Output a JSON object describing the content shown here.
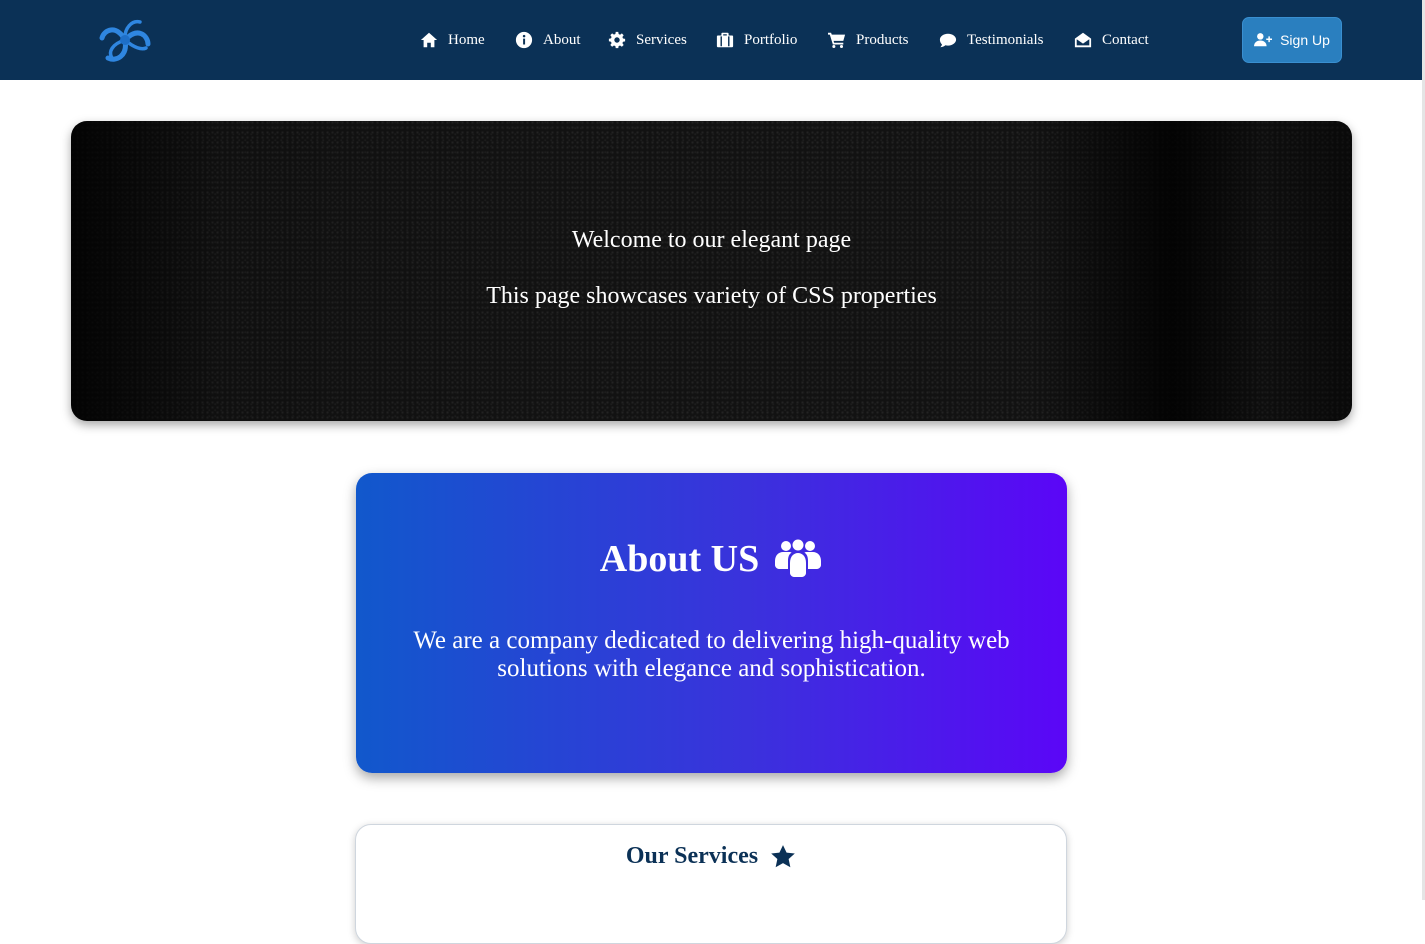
{
  "nav": {
    "items": [
      {
        "label": "Home",
        "icon": "home-icon"
      },
      {
        "label": "About",
        "icon": "info-circle-icon"
      },
      {
        "label": "Services",
        "icon": "gear-icon"
      },
      {
        "label": "Portfolio",
        "icon": "briefcase-icon"
      },
      {
        "label": "Products",
        "icon": "shopping-cart-icon"
      },
      {
        "label": "Testimonials",
        "icon": "comment-icon"
      },
      {
        "label": "Contact",
        "icon": "envelope-open-icon"
      }
    ],
    "signup_label": "Sign Up"
  },
  "hero": {
    "title": "Welcome to our elegant page",
    "subtitle": "This page showcases variety of CSS properties"
  },
  "about": {
    "heading": "About US",
    "text": "We are a company dedicated to delivering high-quality web solutions with elegance and sophistication."
  },
  "services": {
    "heading": "Our Services"
  },
  "colors": {
    "navbar": "#0b3156",
    "signup": "#2a7fbf",
    "about_gradient_start": "#1158cc",
    "about_gradient_end": "#5b06f7"
  }
}
